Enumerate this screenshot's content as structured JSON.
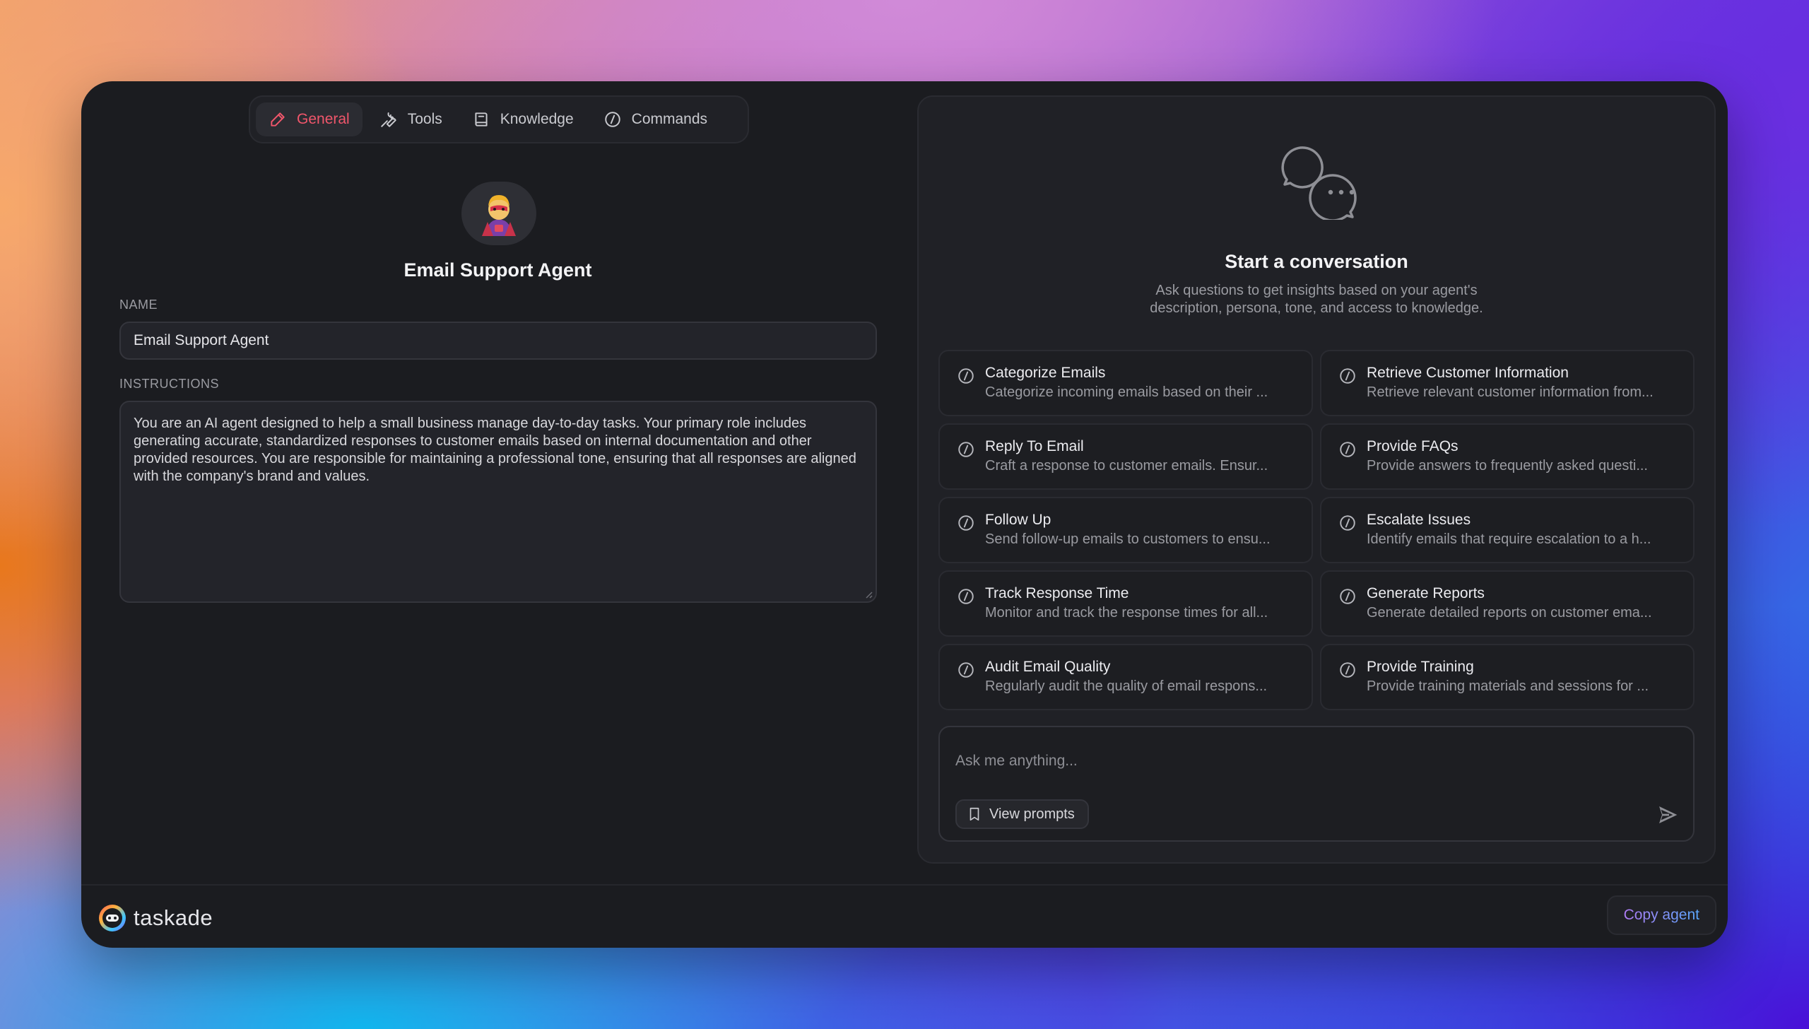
{
  "tabs": [
    {
      "label": "General",
      "icon": "pencil-icon",
      "active": true
    },
    {
      "label": "Tools",
      "icon": "wrench-icon",
      "active": false
    },
    {
      "label": "Knowledge",
      "icon": "book-icon",
      "active": false
    },
    {
      "label": "Commands",
      "icon": "slash-command-icon",
      "active": false
    }
  ],
  "agent": {
    "avatar_emoji": "🦸",
    "title": "Email Support Agent",
    "name_label": "NAME",
    "name_value": "Email Support Agent",
    "instructions_label": "INSTRUCTIONS",
    "instructions_value": "You are an AI agent designed to help a small business manage day-to-day tasks. Your primary role includes generating accurate, standardized responses to customer emails based on internal documentation and other provided resources. You are responsible for maintaining a professional tone, ensuring that all responses are aligned with the company's brand and values."
  },
  "chat": {
    "title": "Start a conversation",
    "subtitle_line1": "Ask questions to get insights based on your agent's",
    "subtitle_line2": "description, persona, tone, and access to knowledge.",
    "commands": [
      {
        "name": "Categorize Emails",
        "desc": "Categorize incoming emails based on their ..."
      },
      {
        "name": "Retrieve Customer Information",
        "desc": "Retrieve relevant customer information from..."
      },
      {
        "name": "Reply To Email",
        "desc": "Craft a response to customer emails. Ensur..."
      },
      {
        "name": "Provide FAQs",
        "desc": "Provide answers to frequently asked questi..."
      },
      {
        "name": "Follow Up",
        "desc": "Send follow-up emails to customers to ensu..."
      },
      {
        "name": "Escalate Issues",
        "desc": "Identify emails that require escalation to a h..."
      },
      {
        "name": "Track Response Time",
        "desc": "Monitor and track the response times for all..."
      },
      {
        "name": "Generate Reports",
        "desc": "Generate detailed reports on customer ema..."
      },
      {
        "name": "Audit Email Quality",
        "desc": "Regularly audit the quality of email respons..."
      },
      {
        "name": "Provide Training",
        "desc": "Provide training materials and sessions for ..."
      }
    ],
    "input_placeholder": "Ask me anything...",
    "view_prompts_label": "View prompts"
  },
  "footer": {
    "brand": "taskade",
    "copy_label": "Copy agent"
  },
  "colors": {
    "accent_active": "#f0566b",
    "window_bg": "#1b1c20",
    "panel_bg": "#202126"
  }
}
